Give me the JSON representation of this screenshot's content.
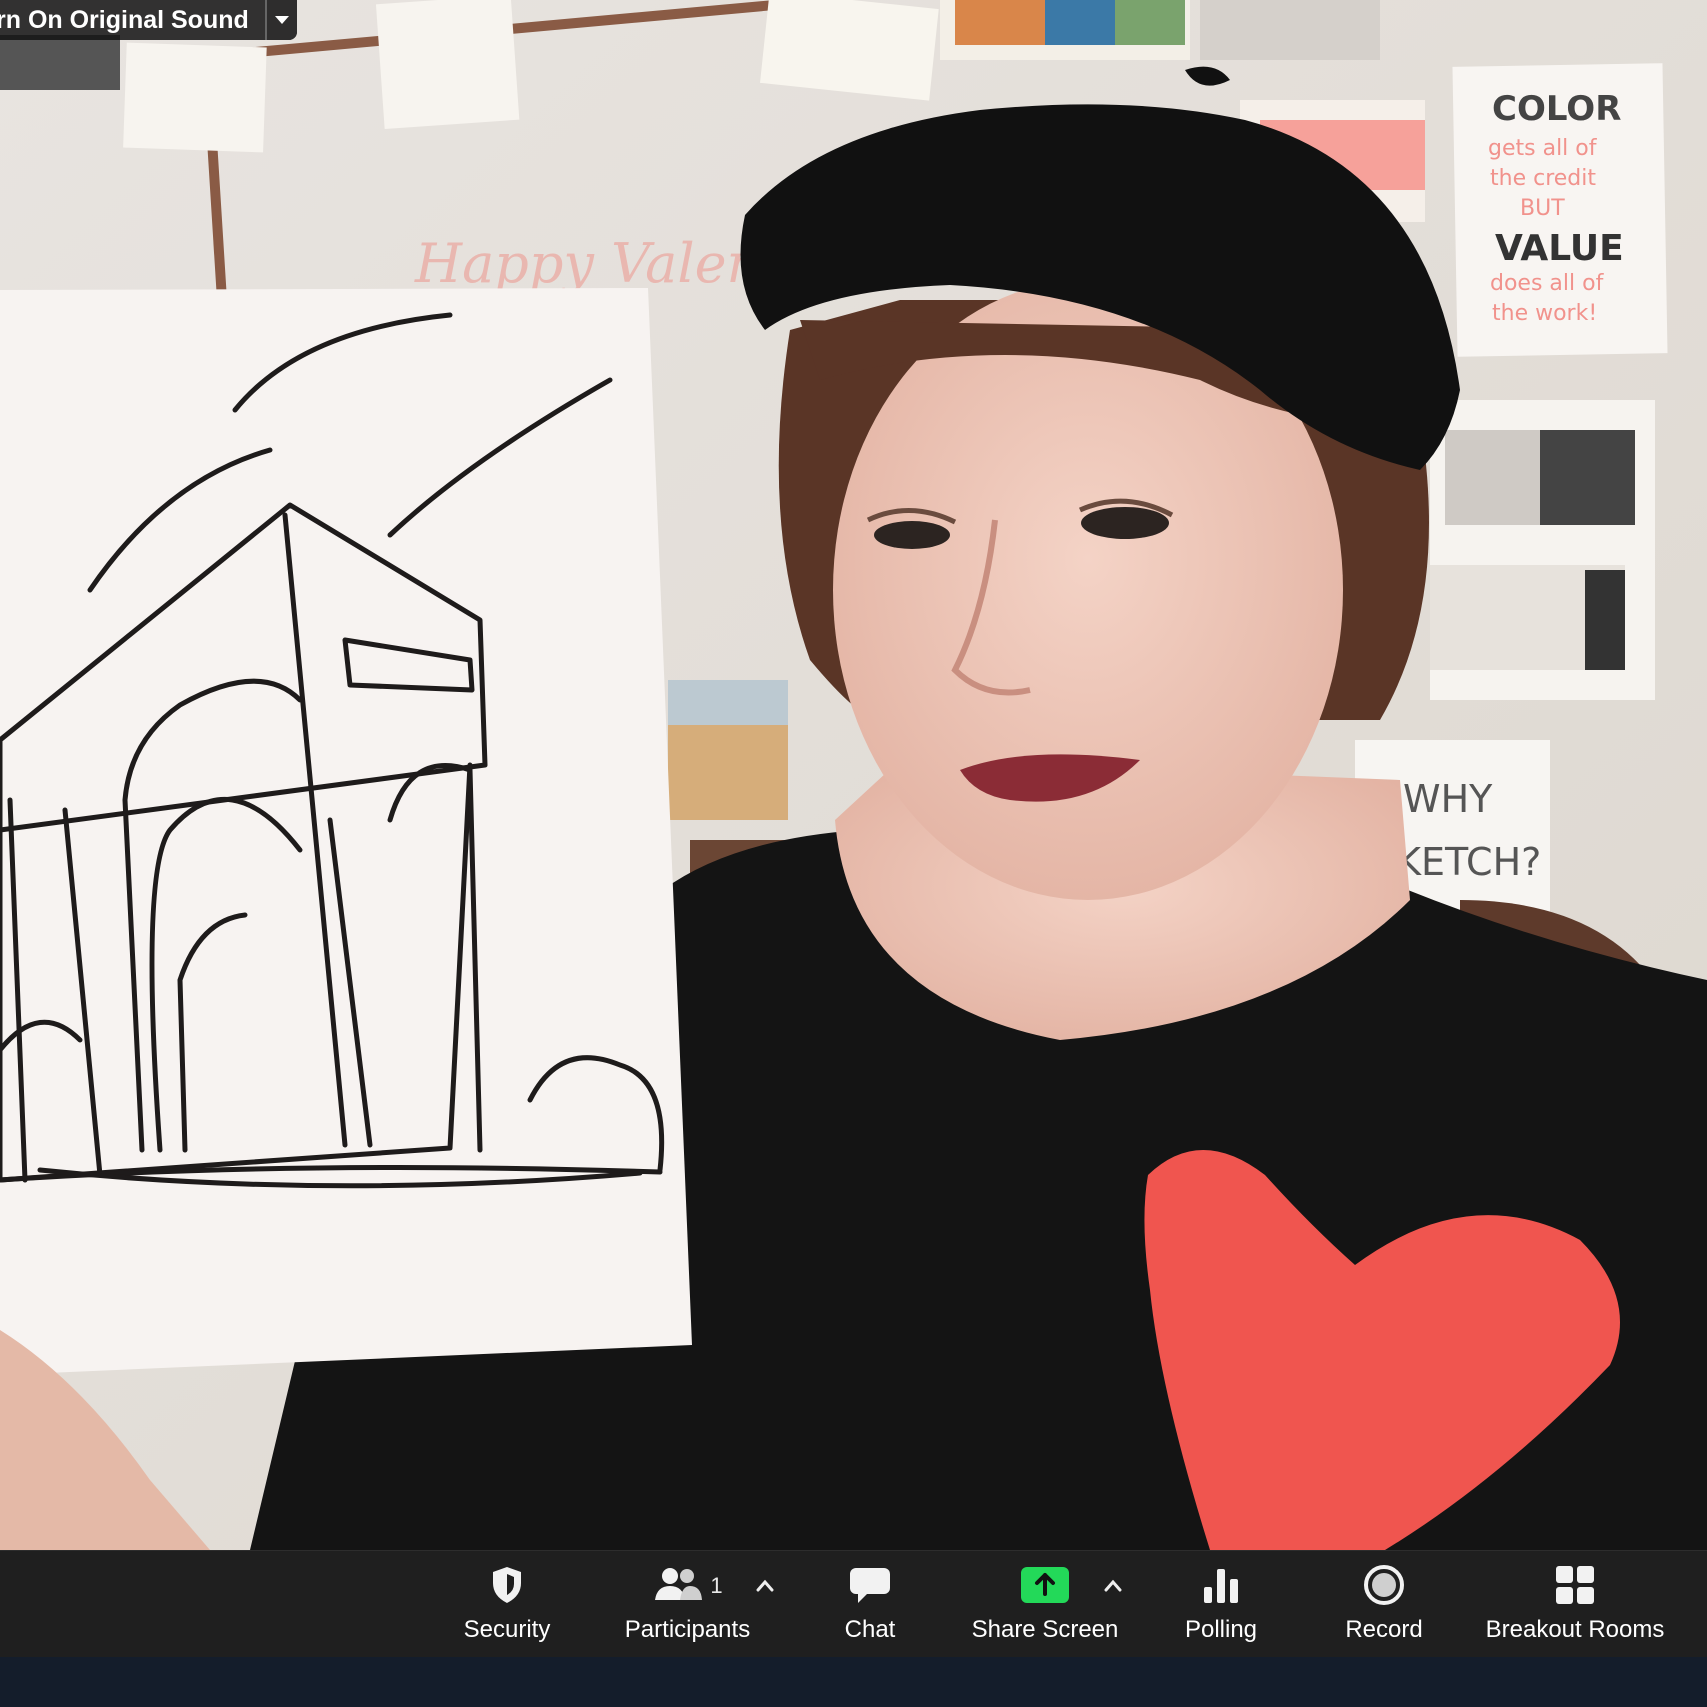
{
  "audio_pill": {
    "label": "rn On Original Sound",
    "dropdown_icon": "chevron-down-icon"
  },
  "video": {
    "wall_text_color_sign": [
      "COLOR",
      "gets all of",
      "the credit",
      "BUT",
      "VALUE",
      "does all of",
      "the work!"
    ],
    "wall_text_sketch_sign": [
      "WHY",
      "SKETCH?"
    ],
    "wall_text_valentine": "Happy Valentines",
    "heart_color": "#f0554f"
  },
  "toolbar": {
    "background": "#1f1f1f",
    "security": {
      "label": "Security",
      "icon": "shield-icon"
    },
    "participants": {
      "label": "Participants",
      "icon": "people-icon",
      "count": "1",
      "caret": "caret-up-icon"
    },
    "chat": {
      "label": "Chat",
      "icon": "chat-bubble-icon"
    },
    "share_screen": {
      "label": "Share Screen",
      "icon": "share-screen-arrow-icon",
      "accent": "#23d959",
      "caret": "caret-up-icon"
    },
    "polling": {
      "label": "Polling",
      "icon": "bar-chart-icon"
    },
    "record": {
      "label": "Record",
      "icon": "record-circle-icon"
    },
    "breakout_rooms": {
      "label": "Breakout Rooms",
      "icon": "grid-icon"
    }
  }
}
